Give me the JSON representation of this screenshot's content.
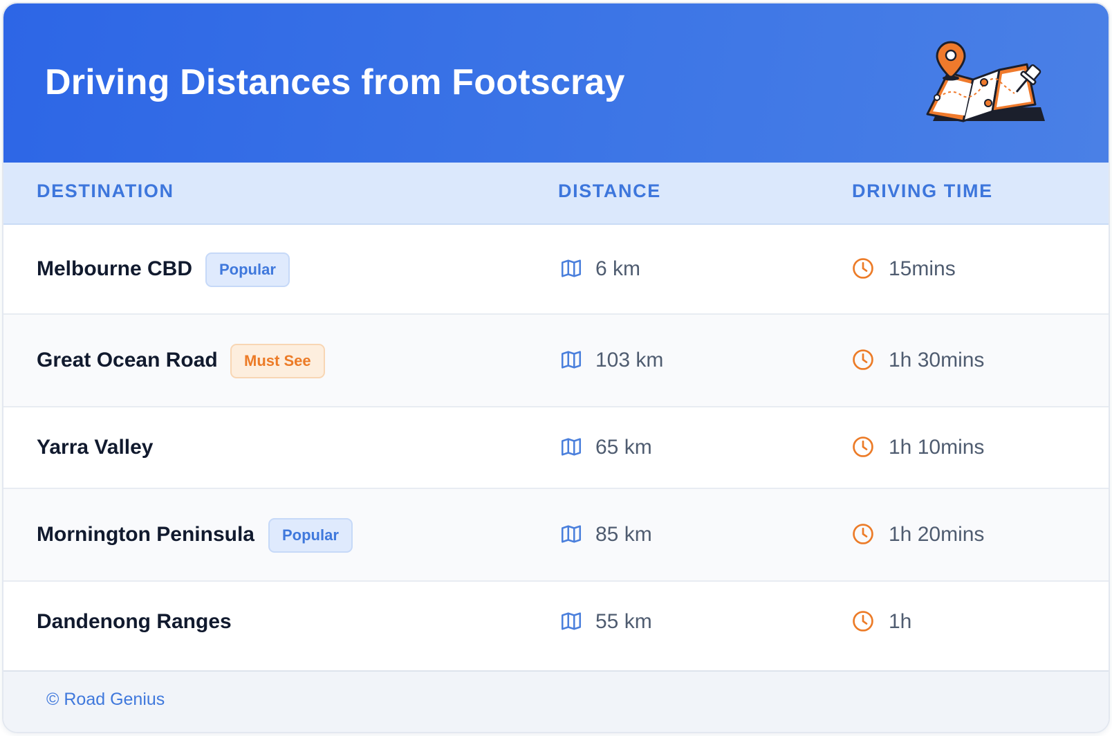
{
  "header": {
    "title": "Driving Distances from Footscray",
    "illustration_icon": "folded-map-with-location-pin-icon"
  },
  "table": {
    "columns": [
      "DESTINATION",
      "DISTANCE",
      "DRIVING TIME"
    ],
    "distance_icon": "map-icon",
    "time_icon": "clock-icon",
    "rows": [
      {
        "destination": "Melbourne CBD",
        "badge": "Popular",
        "badge_color": "blue",
        "distance": "6 km",
        "time": "15mins"
      },
      {
        "destination": "Great Ocean Road",
        "badge": "Must See",
        "badge_color": "orange",
        "distance": "103 km",
        "time": "1h 30mins"
      },
      {
        "destination": "Yarra Valley",
        "badge": "",
        "badge_color": "",
        "distance": "65 km",
        "time": "1h 10mins"
      },
      {
        "destination": "Mornington Peninsula",
        "badge": "Popular",
        "badge_color": "blue",
        "distance": "85 km",
        "time": "1h 20mins"
      },
      {
        "destination": "Dandenong Ranges",
        "badge": "",
        "badge_color": "",
        "distance": "55 km",
        "time": "1h"
      }
    ]
  },
  "footer": {
    "copyright": "© Road Genius"
  },
  "colors": {
    "header_blue": "#2d66e6",
    "accent_blue": "#3d76dc",
    "accent_orange": "#ec7b27",
    "table_header_bg": "#dbe8fc"
  }
}
